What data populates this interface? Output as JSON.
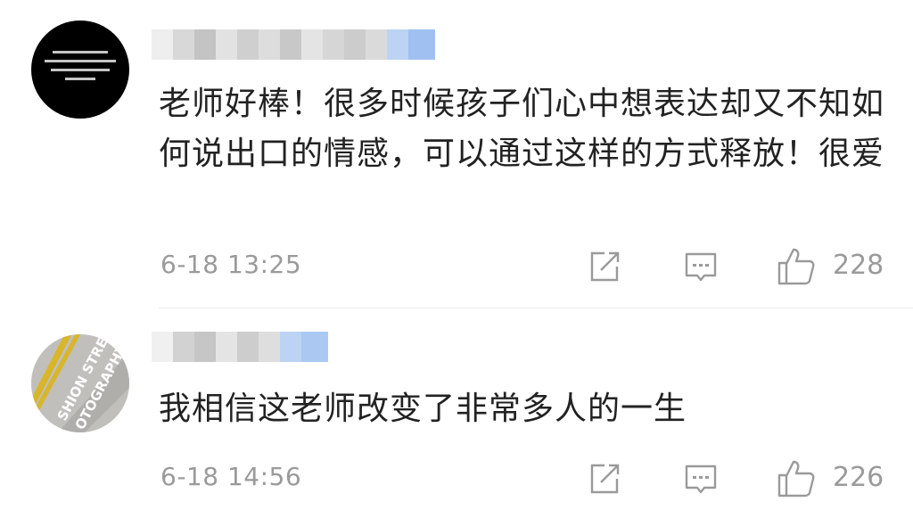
{
  "comments": [
    {
      "avatar_icon": "avatar-black-text-icon",
      "text": "老师好棒！很多时候孩子们心中想表达却又不知如何说出口的情感，可以通过这样的方式释放！很爱",
      "time": "6-18 13:25",
      "likes": "228"
    },
    {
      "avatar_icon": "avatar-street-photo-icon",
      "text": "我相信这老师改变了非常多人的一生",
      "time": "6-18 14:56",
      "likes": "226"
    }
  ],
  "icons": {
    "share": "share-icon",
    "reply": "reply-icon",
    "like": "thumbs-up-icon"
  },
  "colors": {
    "text": "#222222",
    "meta": "#9a9a9a",
    "blur_gray": "#d4d4d4",
    "blur_blue": "#bcd3f3"
  }
}
